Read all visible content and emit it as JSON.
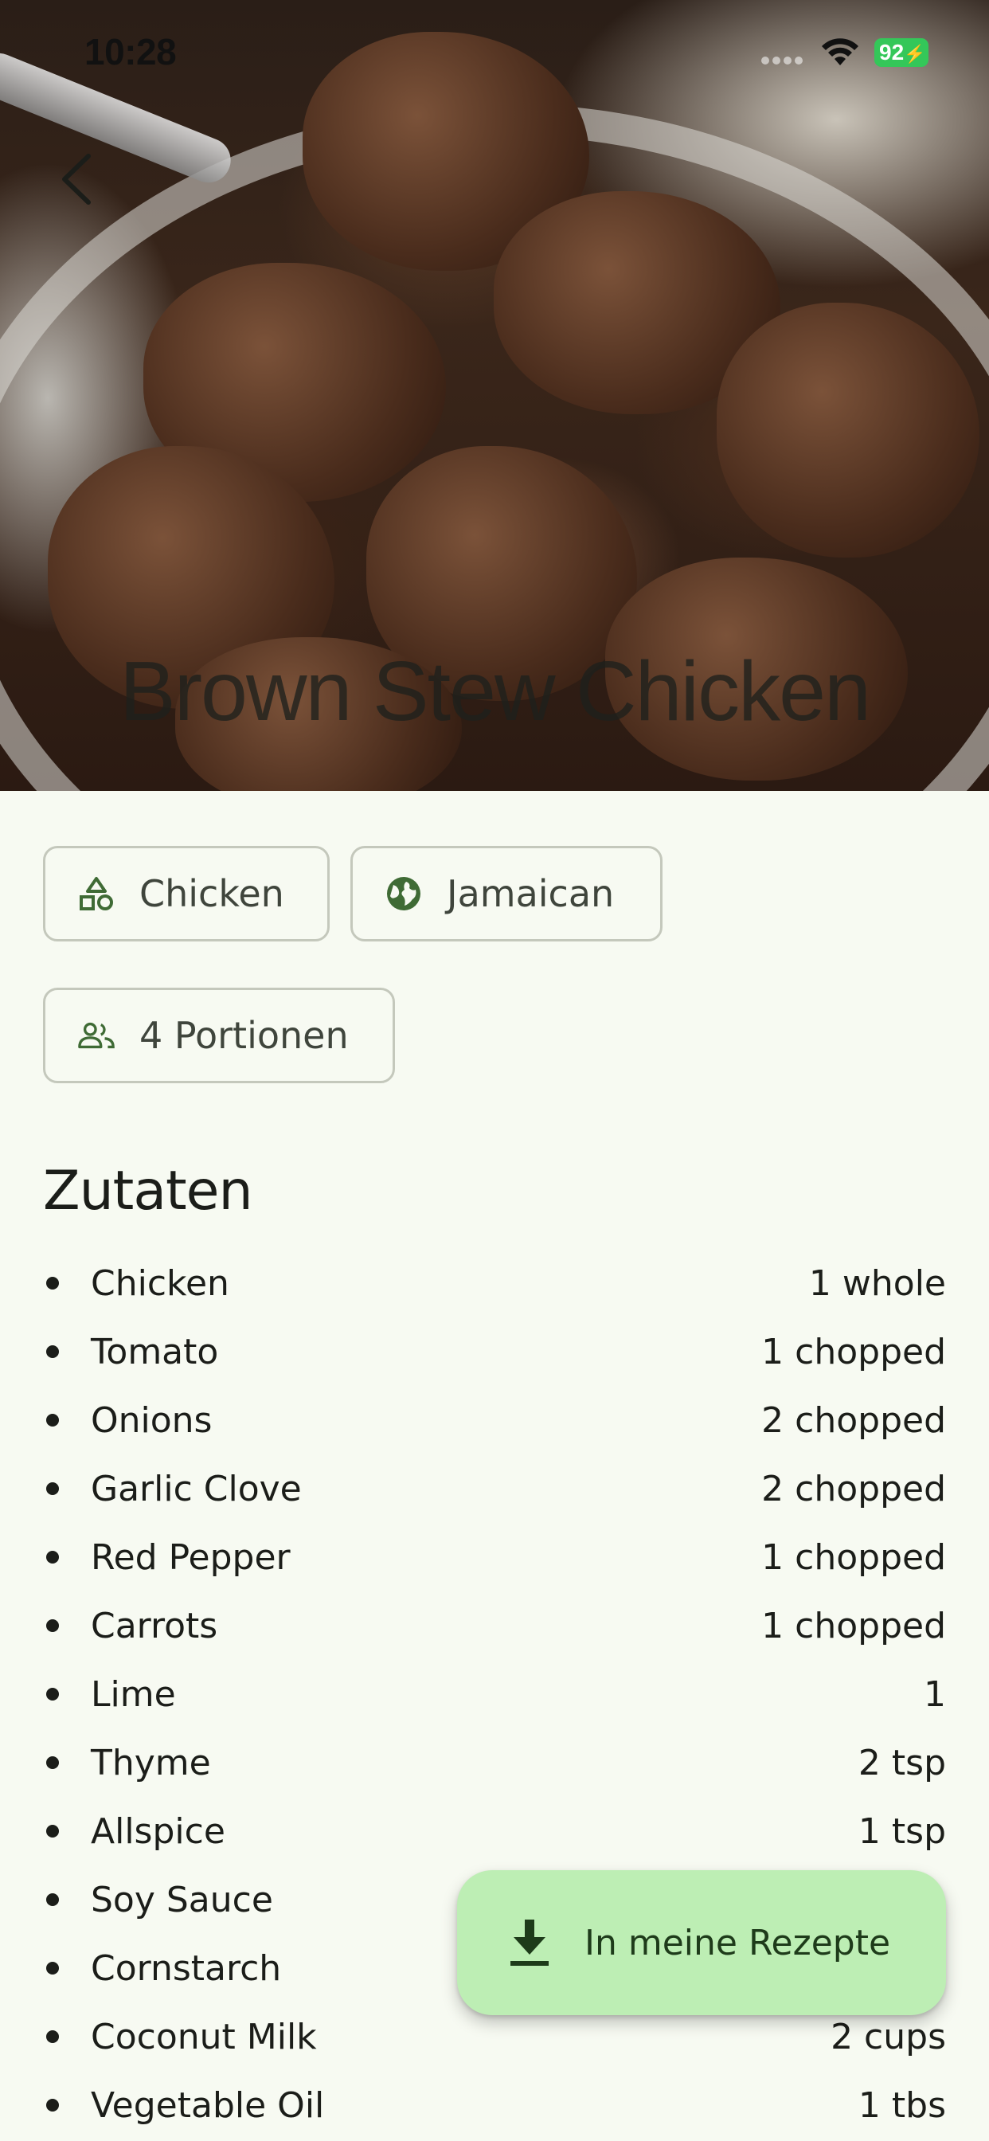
{
  "status_bar": {
    "time": "10:28",
    "battery": "92"
  },
  "recipe": {
    "title": "Brown Stew Chicken",
    "image_icon": "recipe-photo"
  },
  "navigation": {
    "back_icon": "chevron-left-icon"
  },
  "chips": [
    {
      "icon": "category-icon",
      "label": "Chicken"
    },
    {
      "icon": "globe-icon",
      "label": "Jamaican"
    },
    {
      "icon": "people-icon",
      "label": "4 Portionen"
    }
  ],
  "ingredients_section": {
    "title": "Zutaten",
    "items": [
      {
        "name": "Chicken",
        "amount": "1 whole"
      },
      {
        "name": "Tomato",
        "amount": "1 chopped"
      },
      {
        "name": "Onions",
        "amount": "2 chopped"
      },
      {
        "name": "Garlic Clove",
        "amount": "2 chopped"
      },
      {
        "name": "Red Pepper",
        "amount": "1 chopped"
      },
      {
        "name": "Carrots",
        "amount": "1 chopped"
      },
      {
        "name": "Lime",
        "amount": "1"
      },
      {
        "name": "Thyme",
        "amount": "2 tsp"
      },
      {
        "name": "Allspice",
        "amount": "1 tsp"
      },
      {
        "name": "Soy Sauce",
        "amount": ""
      },
      {
        "name": "Cornstarch",
        "amount": ""
      },
      {
        "name": "Coconut Milk",
        "amount": "2 cups"
      },
      {
        "name": "Vegetable Oil",
        "amount": "1 tbs"
      }
    ]
  },
  "fab": {
    "label": "In meine Rezepte",
    "icon": "download-icon"
  },
  "colors": {
    "background": "#f7faf2",
    "accent": "#3f6b35",
    "fab_background": "#bdeeb4",
    "chip_border": "#c4c8bc",
    "battery": "#34c759"
  }
}
